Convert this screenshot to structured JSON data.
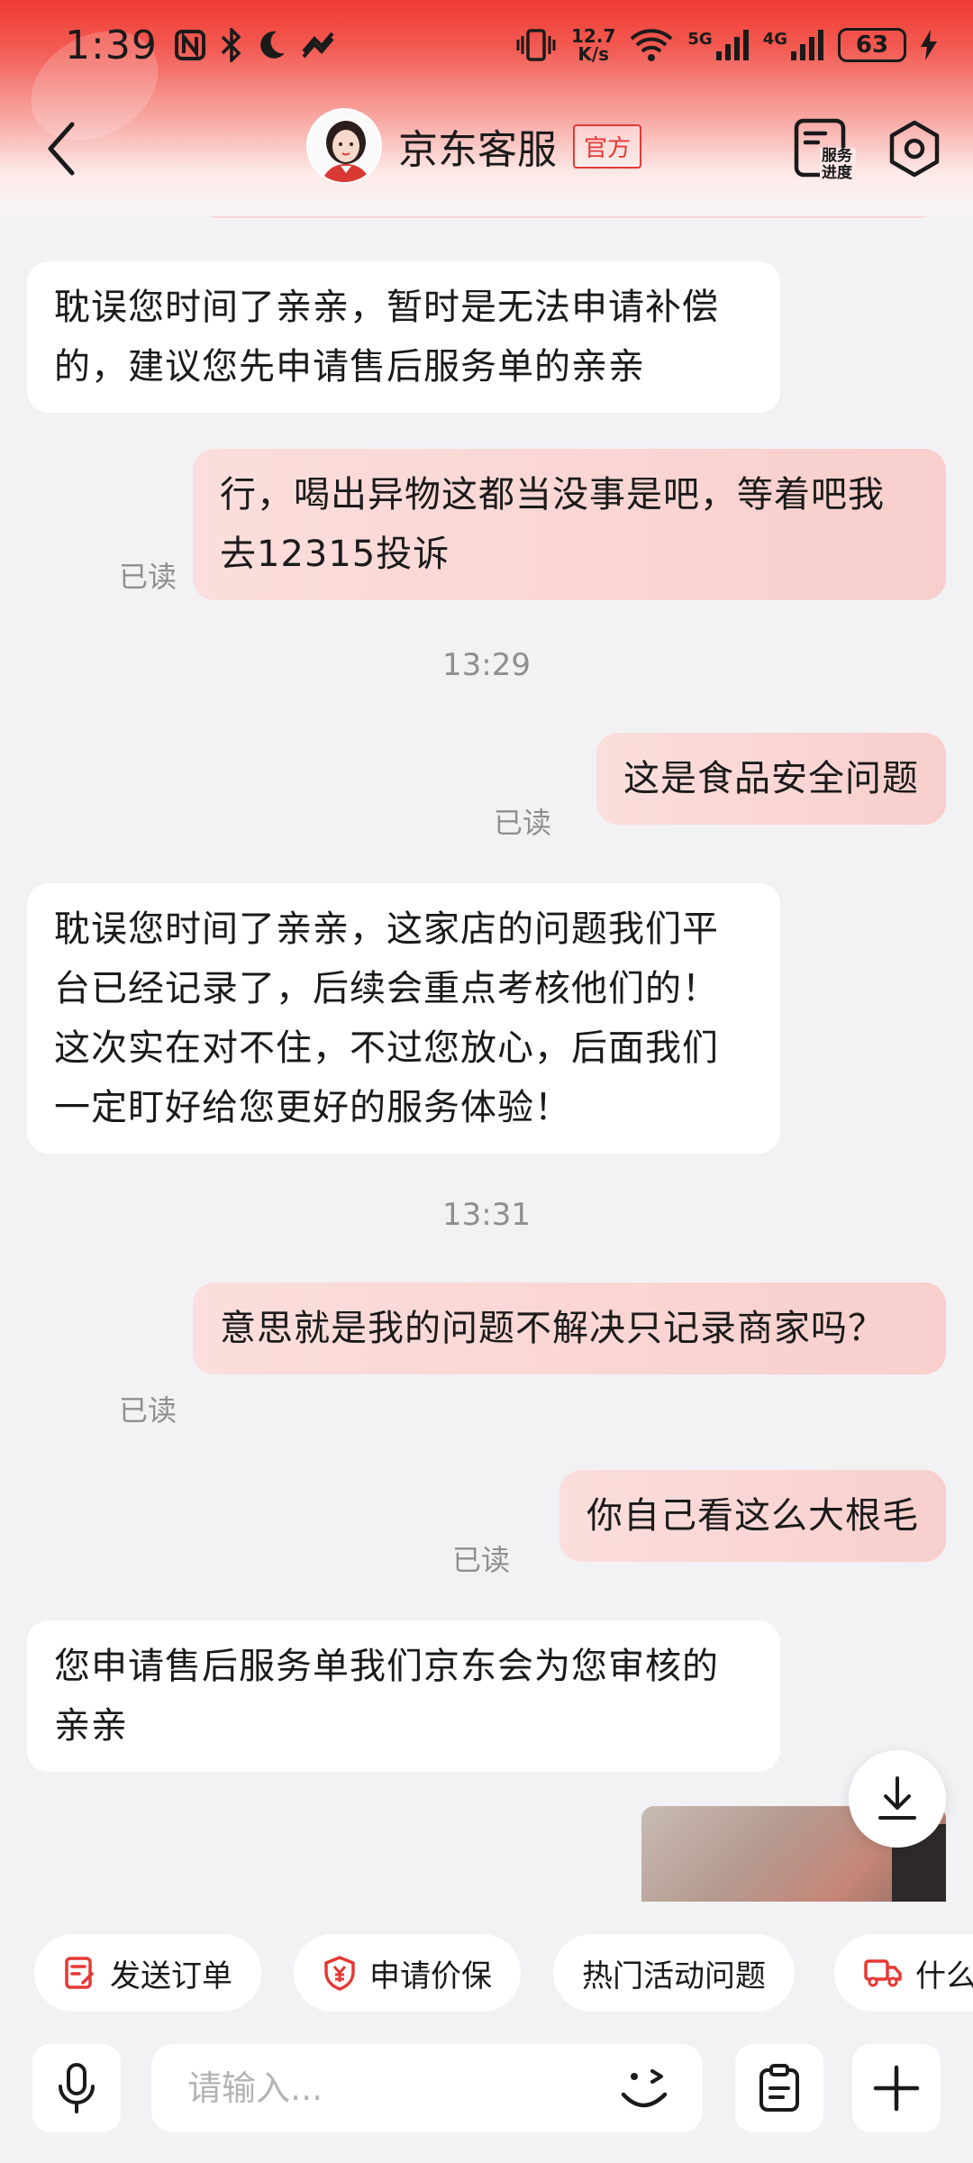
{
  "status_bar": {
    "time": "1:39",
    "net_speed_value": "12.7",
    "net_speed_unit": "K/s",
    "signal1_label": "5G",
    "signal2_label": "4G",
    "battery": "63"
  },
  "header": {
    "title": "京东客服",
    "badge": "官方",
    "service_label": "服务\n进度"
  },
  "messages": [
    {
      "side": "in",
      "text": "耽误您时间了亲亲，暂时是无法申请补偿的，建议您先申请售后服务单的亲亲"
    },
    {
      "side": "out",
      "text": "行，喝出异物这都当没事是吧，等着吧我去12315投诉",
      "read": "已读"
    },
    {
      "type": "time",
      "text": "13:29"
    },
    {
      "side": "out",
      "text": "这是食品安全问题",
      "read": "已读"
    },
    {
      "side": "in",
      "text": "耽误您时间了亲亲，这家店的问题我们平台已经记录了，后续会重点考核他们的！这次实在对不住，不过您放心，后面我们一定盯好给您更好的服务体验！"
    },
    {
      "type": "time",
      "text": "13:31"
    },
    {
      "side": "out",
      "text": "意思就是我的问题不解决只记录商家吗？",
      "read": "已读"
    },
    {
      "side": "out",
      "text": "你自己看这么大根毛",
      "read": "已读"
    },
    {
      "side": "in",
      "text": "您申请售后服务单我们京东会为您审核的亲亲"
    }
  ],
  "quick_actions": [
    {
      "label": "发送订单",
      "icon": "order-icon"
    },
    {
      "label": "申请价保",
      "icon": "price-protect-icon"
    },
    {
      "label": "热门活动问题",
      "icon": ""
    },
    {
      "label": "什么",
      "icon": "truck-icon"
    }
  ],
  "input": {
    "placeholder": "请输入..."
  },
  "colors": {
    "brand_red": "#e53935",
    "out_bubble": "#f9d6d4",
    "in_bubble": "#ffffff"
  }
}
